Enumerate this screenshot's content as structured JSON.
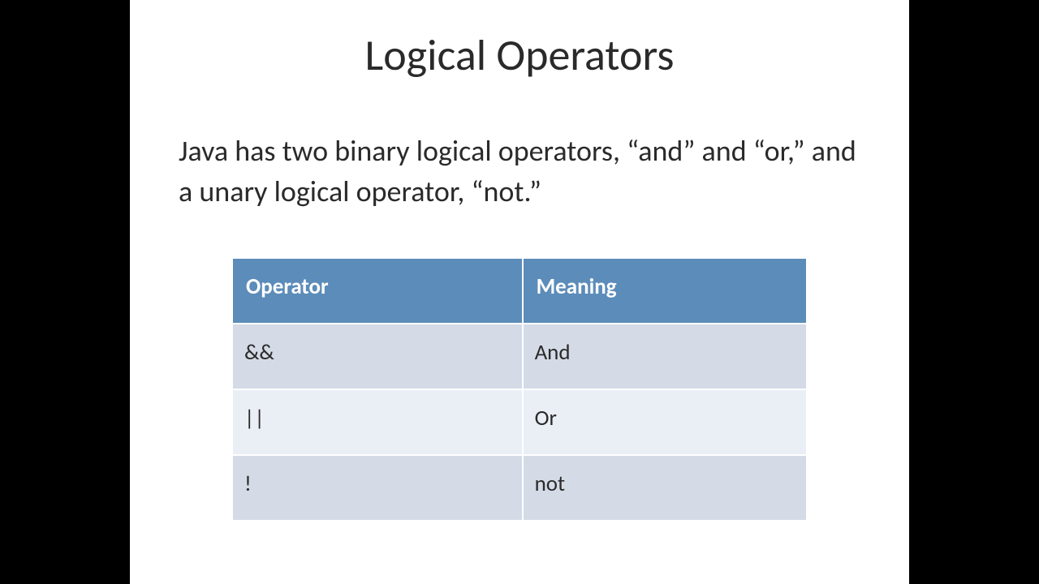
{
  "title": "Logical Operators",
  "body": "Java has two binary logical operators, “and” and “or,” and a unary logical operator, “not.”",
  "table": {
    "headers": [
      "Operator",
      "Meaning"
    ],
    "rows": [
      [
        "&&",
        "And"
      ],
      [
        "||",
        "Or"
      ],
      [
        "!",
        "not"
      ]
    ]
  }
}
